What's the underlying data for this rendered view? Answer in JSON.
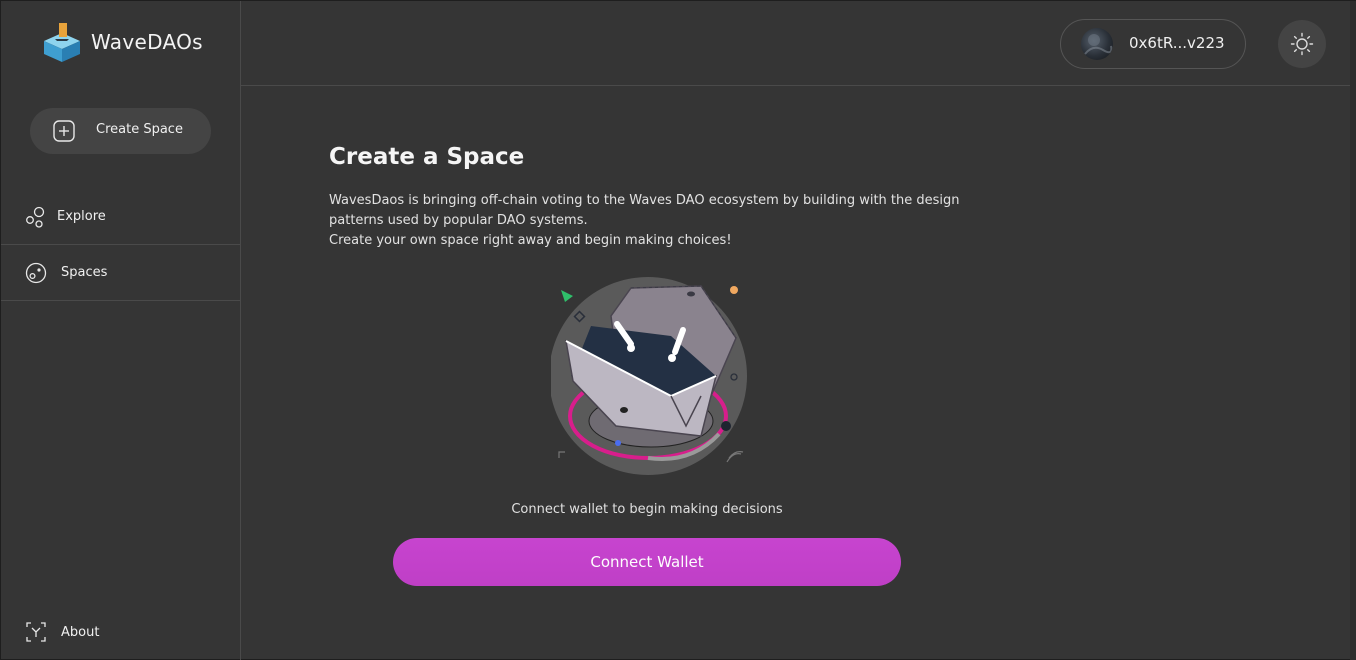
{
  "app": {
    "name": "WaveDAOs"
  },
  "sidebar": {
    "create_label": "Create Space",
    "items": [
      {
        "label": "Explore",
        "icon": "bubbles-icon"
      },
      {
        "label": "Spaces",
        "icon": "spaces-icon"
      }
    ],
    "about_label": "About"
  },
  "header": {
    "wallet_address": "0x6tR...v223",
    "theme_icon": "sun-icon"
  },
  "main": {
    "title": "Create a Space",
    "description_line1": "WavesDaos is bringing off-chain voting to the Waves DAO ecosystem by building with the design patterns used by popular DAO systems.",
    "description_line2": "Create your own space right away and begin making choices!",
    "connect_text": "Connect wallet to begin making decisions",
    "connect_button": "Connect Wallet"
  },
  "colors": {
    "background": "#353535",
    "accent": "#c443cc",
    "panel": "#444444"
  }
}
